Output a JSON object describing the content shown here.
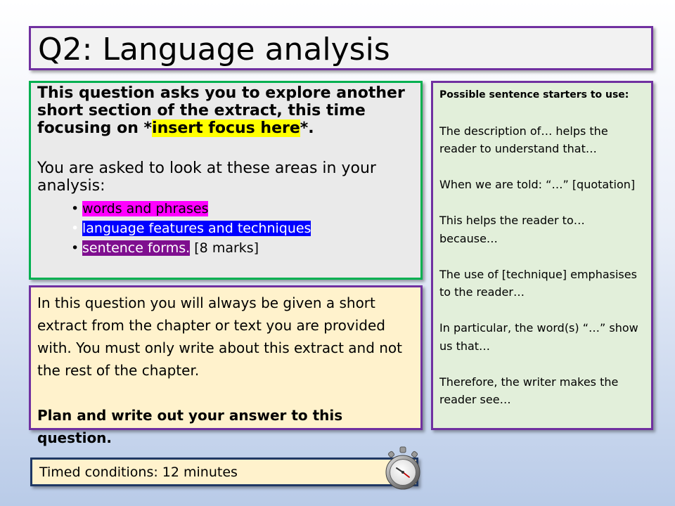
{
  "title": "Q2: Language analysis",
  "task": {
    "intro_start": "This question asks you to explore another short section of the extract, this time focusing on *",
    "intro_highlight": "insert focus here",
    "intro_end": "*.",
    "areas_intro": "You are asked to look at these areas in your analysis:",
    "bullets": [
      {
        "text": "words and phrases",
        "highlight": "#ff00ff"
      },
      {
        "text": "language features and techniques",
        "highlight": "#0000ff"
      },
      {
        "text": "sentence forms.",
        "highlight": "#7f0f8f"
      }
    ],
    "marks": " [8 marks]"
  },
  "info": {
    "text": "In this question you will always be given a short extract from the chapter or text you are provided with. You must only write about this extract and not the rest of the chapter.",
    "instruction": "Plan and write out your answer to this question."
  },
  "starters": {
    "heading": "Possible sentence starters to use:",
    "items": [
      "The description of… helps the reader to understand that…",
      "When we are told: “…” [quotation]",
      "This helps the reader to… because…",
      "The use of [technique] emphasises to the reader…",
      "In particular, the word(s) “…” show us that…",
      "Therefore, the writer makes the reader see…"
    ]
  },
  "timer": {
    "label": "Timed conditions: 12 minutes",
    "icon": "stopwatch-icon"
  },
  "colors": {
    "title_border": "#7030a0",
    "task_border": "#00b050",
    "starters_bg": "#e2efda",
    "info_bg": "#fff2cc"
  }
}
